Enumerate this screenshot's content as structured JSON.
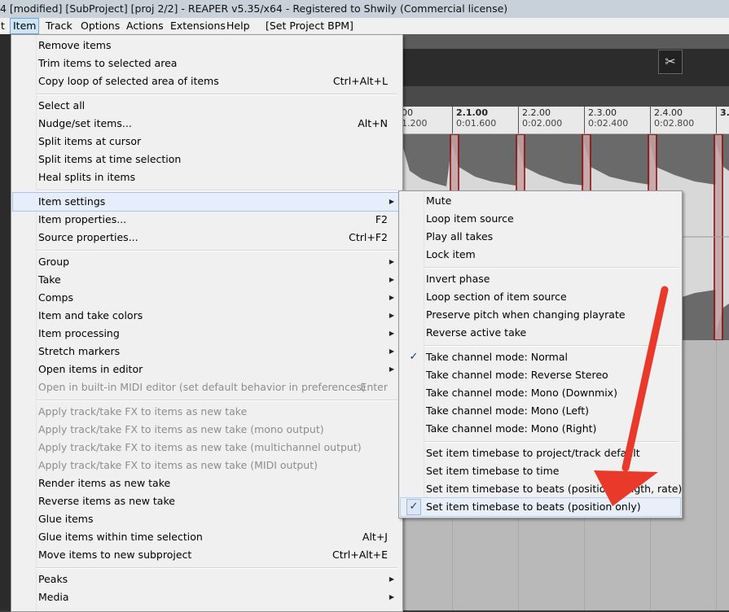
{
  "titlebar": {
    "text": "4 [modified] [SubProject] [proj 2/2] - REAPER v5.35/x64 - Registered to Shwily (Commercial license)"
  },
  "menubar": {
    "items": [
      {
        "label": "t"
      },
      {
        "label": "Item"
      },
      {
        "label": "Track"
      },
      {
        "label": "Options"
      },
      {
        "label": "Actions"
      },
      {
        "label": "Extensions"
      },
      {
        "label": "Help"
      },
      {
        "label": "[Set Project BPM]"
      }
    ]
  },
  "ruler": {
    "ticks": [
      {
        "top": "00",
        "bottom": "1.200"
      },
      {
        "top": "2.1.00",
        "bottom": "0:01.600"
      },
      {
        "top": "2.2.00",
        "bottom": "0:02.000"
      },
      {
        "top": "2.3.00",
        "bottom": "0:02.400"
      },
      {
        "top": "2.4.00",
        "bottom": "0:02.800"
      },
      {
        "top": "3.",
        "bottom": ""
      }
    ]
  },
  "item_menu": {
    "items": [
      {
        "label": "Remove items",
        "shortcut": ""
      },
      {
        "label": "Trim items to selected area",
        "shortcut": ""
      },
      {
        "label": "Copy loop of selected area of items",
        "shortcut": "Ctrl+Alt+L"
      },
      {
        "label": "Select all",
        "shortcut": ""
      },
      {
        "label": "Nudge/set items...",
        "shortcut": "Alt+N"
      },
      {
        "label": "Split items at cursor",
        "shortcut": ""
      },
      {
        "label": "Split items at time selection",
        "shortcut": ""
      },
      {
        "label": "Heal splits in items",
        "shortcut": ""
      },
      {
        "label": "Item settings",
        "shortcut": ""
      },
      {
        "label": "Item properties...",
        "shortcut": "F2"
      },
      {
        "label": "Source properties...",
        "shortcut": "Ctrl+F2"
      },
      {
        "label": "Group",
        "shortcut": ""
      },
      {
        "label": "Take",
        "shortcut": ""
      },
      {
        "label": "Comps",
        "shortcut": ""
      },
      {
        "label": "Item and take colors",
        "shortcut": ""
      },
      {
        "label": "Item processing",
        "shortcut": ""
      },
      {
        "label": "Stretch markers",
        "shortcut": ""
      },
      {
        "label": "Open items in editor",
        "shortcut": ""
      },
      {
        "label": "Open in built-in MIDI editor (set default behavior in preferences)",
        "shortcut": "Enter"
      },
      {
        "label": "Apply track/take FX to items as new take",
        "shortcut": ""
      },
      {
        "label": "Apply track/take FX to items as new take (mono output)",
        "shortcut": ""
      },
      {
        "label": "Apply track/take FX to items as new take (multichannel output)",
        "shortcut": ""
      },
      {
        "label": "Apply track/take FX to items as new take (MIDI output)",
        "shortcut": ""
      },
      {
        "label": "Render items as new take",
        "shortcut": ""
      },
      {
        "label": "Reverse items as new take",
        "shortcut": ""
      },
      {
        "label": "Glue items",
        "shortcut": ""
      },
      {
        "label": "Glue items within time selection",
        "shortcut": "Alt+J"
      },
      {
        "label": "Move items to new subproject",
        "shortcut": "Ctrl+Alt+E"
      },
      {
        "label": "Peaks",
        "shortcut": ""
      },
      {
        "label": "Media",
        "shortcut": ""
      }
    ]
  },
  "item_settings_menu": {
    "items": [
      {
        "label": "Mute"
      },
      {
        "label": "Loop item source"
      },
      {
        "label": "Play all takes"
      },
      {
        "label": "Lock item"
      },
      {
        "label": "Invert phase"
      },
      {
        "label": "Loop section of item source"
      },
      {
        "label": "Preserve pitch when changing playrate"
      },
      {
        "label": "Reverse active take"
      },
      {
        "label": "Take channel mode: Normal"
      },
      {
        "label": "Take channel mode: Reverse Stereo"
      },
      {
        "label": "Take channel mode: Mono (Downmix)"
      },
      {
        "label": "Take channel mode: Mono (Left)"
      },
      {
        "label": "Take channel mode: Mono (Right)"
      },
      {
        "label": "Set item timebase to project/track default"
      },
      {
        "label": "Set item timebase to time"
      },
      {
        "label": "Set item timebase to beats (position, length, rate)"
      },
      {
        "label": "Set item timebase to beats (position only)"
      }
    ],
    "check_glyph": "✓"
  },
  "glyphs": {
    "submenu_arrow": "▶",
    "scissors": "✂"
  },
  "colors": {
    "annotation_arrow": "#e8392b",
    "highlight": "#e5eefa",
    "waveform": "#555555"
  }
}
